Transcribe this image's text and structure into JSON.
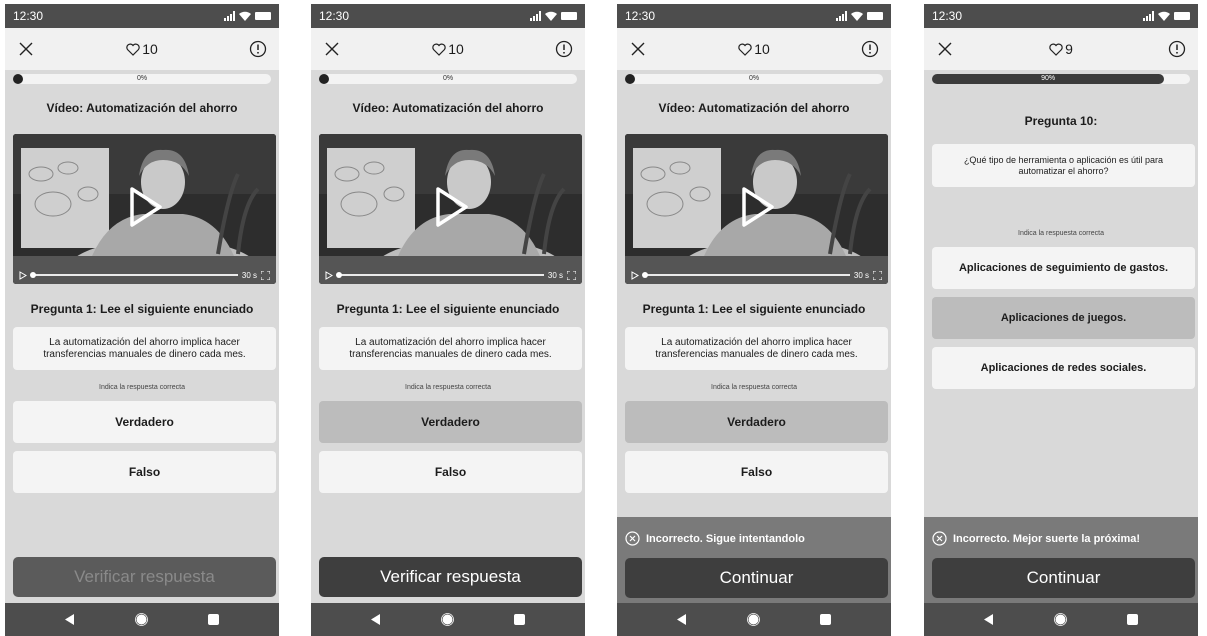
{
  "status": {
    "time": "12:30"
  },
  "icons": {
    "close": "close-icon",
    "heart": "heart-icon",
    "report": "alert-circle-icon",
    "play": "play-icon",
    "fullscreen": "fullscreen-icon",
    "error": "x-circle-icon",
    "back": "nav-back-icon",
    "home": "nav-home-icon",
    "recents": "nav-recents-icon"
  },
  "colors": {
    "status_bar": "#4d4d4d",
    "screen_bg": "#d9d9d9",
    "card": "#f4f4f4",
    "selected": "#bcbcbc",
    "button": "#3e3e3e",
    "feedback_bg": "#7a7a7a"
  },
  "screens": [
    {
      "lives": "10",
      "progress": {
        "percent": 0,
        "label": "0%"
      },
      "video_title": "Vídeo: Automatización del ahorro",
      "video": {
        "duration": "30 s"
      },
      "question_title": "Pregunta 1: Lee el siguiente enunciado",
      "statement": "La automatización del ahorro implica hacer transferencias manuales de dinero cada mes.",
      "hint": "Indica la respuesta correcta",
      "options": [
        {
          "label": "Verdadero",
          "selected": false
        },
        {
          "label": "Falso",
          "selected": false
        }
      ],
      "verify_button": {
        "label": "Verificar respuesta",
        "enabled": false
      }
    },
    {
      "lives": "10",
      "progress": {
        "percent": 0,
        "label": "0%"
      },
      "video_title": "Vídeo: Automatización del ahorro",
      "video": {
        "duration": "30 s"
      },
      "question_title": "Pregunta 1: Lee el siguiente enunciado",
      "statement": "La automatización del ahorro implica hacer transferencias manuales de dinero cada mes.",
      "hint": "Indica la respuesta correcta",
      "options": [
        {
          "label": "Verdadero",
          "selected": true
        },
        {
          "label": "Falso",
          "selected": false
        }
      ],
      "verify_button": {
        "label": "Verificar respuesta",
        "enabled": true
      }
    },
    {
      "lives": "10",
      "progress": {
        "percent": 0,
        "label": "0%"
      },
      "video_title": "Vídeo: Automatización del ahorro",
      "video": {
        "duration": "30 s"
      },
      "question_title": "Pregunta 1: Lee el siguiente enunciado",
      "statement": "La automatización del ahorro implica hacer transferencias manuales de dinero cada mes.",
      "hint": "Indica la respuesta correcta",
      "options": [
        {
          "label": "Verdadero",
          "selected": true
        },
        {
          "label": "Falso",
          "selected": false
        }
      ],
      "feedback": {
        "message": "Incorrecto. Sigue intentandolo",
        "button": "Continuar"
      }
    },
    {
      "lives": "9",
      "progress": {
        "percent": 90,
        "label": "90%"
      },
      "question_title": "Pregunta 10:",
      "statement": "¿Qué tipo de herramienta o aplicación es útil para automatizar el ahorro?",
      "hint": "Indica la respuesta correcta",
      "options": [
        {
          "label": "Aplicaciones de seguimiento de gastos.",
          "selected": false
        },
        {
          "label": "Aplicaciones de juegos.",
          "selected": true
        },
        {
          "label": "Aplicaciones de redes sociales.",
          "selected": false
        }
      ],
      "feedback": {
        "message": "Incorrecto. Mejor suerte la próxima!",
        "button": "Continuar"
      }
    }
  ]
}
